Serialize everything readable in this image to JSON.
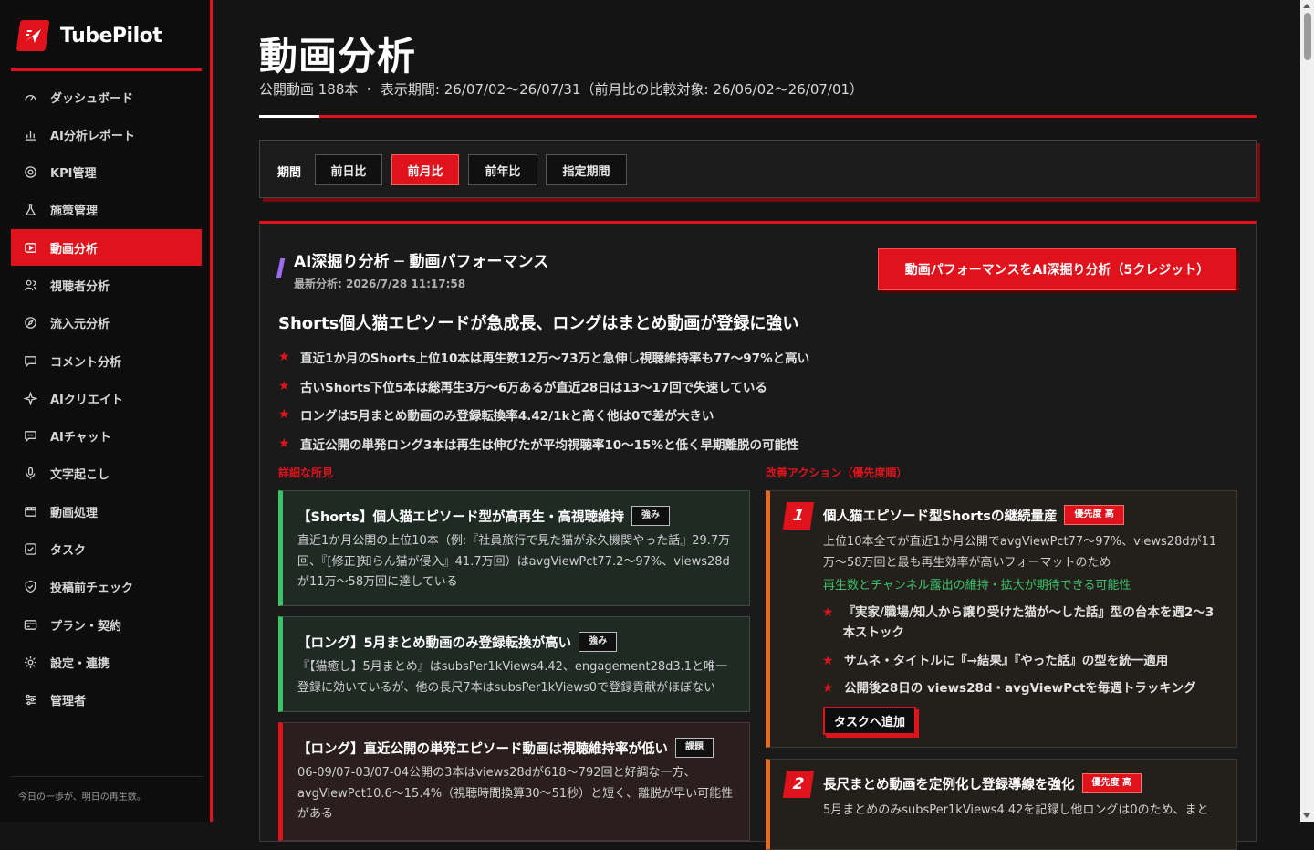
{
  "app": {
    "name": "TubePilot",
    "tagline": "今日の一歩が、明日の再生数。"
  },
  "sidebar": {
    "items": [
      {
        "label": "ダッシュボード",
        "icon": "gauge-icon"
      },
      {
        "label": "AI分析レポート",
        "icon": "bar-chart-icon"
      },
      {
        "label": "KPI管理",
        "icon": "target-icon"
      },
      {
        "label": "施策管理",
        "icon": "flask-icon"
      },
      {
        "label": "動画分析",
        "icon": "video-icon",
        "active": true
      },
      {
        "label": "視聴者分析",
        "icon": "users-icon"
      },
      {
        "label": "流入元分析",
        "icon": "compass-icon"
      },
      {
        "label": "コメント分析",
        "icon": "comment-icon"
      },
      {
        "label": "AIクリエイト",
        "icon": "sparkle-icon"
      },
      {
        "label": "AIチャット",
        "icon": "chat-icon"
      },
      {
        "label": "文字起こし",
        "icon": "mic-icon"
      },
      {
        "label": "動画処理",
        "icon": "film-icon"
      },
      {
        "label": "タスク",
        "icon": "checkbox-icon"
      },
      {
        "label": "投稿前チェック",
        "icon": "shield-icon"
      },
      {
        "label": "プラン・契約",
        "icon": "card-icon"
      },
      {
        "label": "設定・連携",
        "icon": "gear-icon"
      },
      {
        "label": "管理者",
        "icon": "sliders-icon"
      }
    ]
  },
  "page": {
    "title": "動画分析",
    "subtitle": "公開動画 188本 ・ 表示期間: 26/07/02〜26/07/31（前月比の比較対象: 26/06/02〜26/07/01）"
  },
  "period": {
    "label": "期間",
    "options": [
      "前日比",
      "前月比",
      "前年比",
      "指定期間"
    ],
    "selected": "前月比"
  },
  "ai": {
    "title": "AI深掘り分析 ─ 動画パフォーマンス",
    "updated": "最新分析: 2026/7/28 11:17:58",
    "button": "動画パフォーマンスをAI深掘り分析（5クレジット）",
    "headline": "Shorts個人猫エピソードが急成長、ロングはまとめ動画が登録に強い",
    "bullets": [
      "直近1か月のShorts上位10本は再生数12万〜73万と急伸し視聴維持率も77〜97%と高い",
      "古いShorts下位5本は総再生3万〜6万あるが直近28日は13〜17回で失速している",
      "ロングは5月まとめ動画のみ登録転換率4.42/1kと高く他は0で差が大きい",
      "直近公開の単発ロング3本は再生は伸びたが平均視聴率10〜15%と低く早期離脱の可能性"
    ],
    "findings_label": "詳細な所見",
    "actions_label": "改善アクション（優先度順）",
    "findings": [
      {
        "title": "【Shorts】個人猫エピソード型が高再生・高視聴維持",
        "tag": "強み",
        "body": "直近1か月公開の上位10本（例:『社員旅行で見た猫が永久機関やった話』29.7万回、『[修正]知らん猫が侵入』41.7万回）はavgViewPct77.2〜97%、views28dが11万〜58万回に達している"
      },
      {
        "title": "【ロング】5月まとめ動画のみ登録転換が高い",
        "tag": "強み",
        "body": "『【猫癒し】5月まとめ』はsubsPer1kViews4.42、engagement28d3.1と唯一登録に効いているが、他の長尺7本はsubsPer1kViews0で登録貢献がほぼない"
      },
      {
        "title": "【ロング】直近公開の単発エピソード動画は視聴維持率が低い",
        "tag": "課題",
        "body": "06-09/07-03/07-04公開の3本はviews28dが618〜792回と好調な一方、avgViewPct10.6〜15.4%（視聴時間換算30〜51秒）と短く、離脱が早い可能性がある"
      }
    ],
    "actions": [
      {
        "num": "1",
        "title": "個人猫エピソード型Shortsの継続量産",
        "priority": "優先度 高",
        "body": "上位10本全てが直近1か月公開でavgViewPct77〜97%、views28dが11万〜58万回と最も再生効率が高いフォーマットのため",
        "impact": "再生数とチャンネル露出の維持・拡大が期待できる可能性",
        "steps": [
          "『実家/職場/知人から譲り受けた猫が〜した話』型の台本を週2〜3本ストック",
          "サムネ・タイトルに『→結果』『やった話』の型を統一適用",
          "公開後28日の views28d・avgViewPctを毎週トラッキング"
        ],
        "task_button": "タスクへ追加"
      },
      {
        "num": "2",
        "title": "長尺まとめ動画を定例化し登録導線を強化",
        "priority": "優先度 高",
        "body": "5月まとめのみsubsPer1kViews4.42を記録し他ロングは0のため、まと"
      }
    ]
  },
  "colors": {
    "accent": "#e0121c",
    "positive": "#3cc36a",
    "warning": "#e86a1e",
    "ai_accent": "#9b6cf0"
  }
}
